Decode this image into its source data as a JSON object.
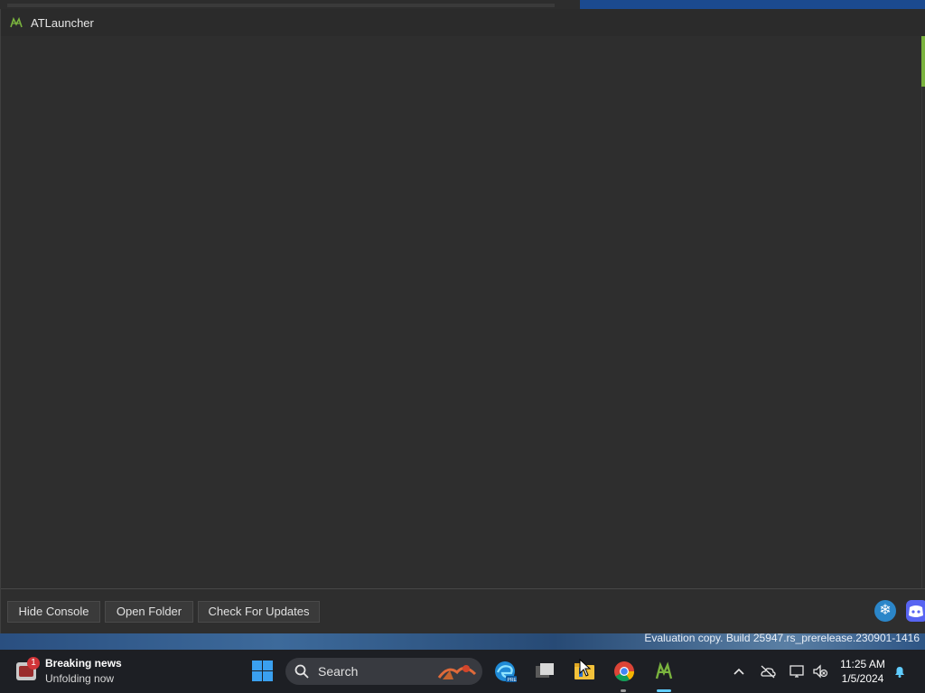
{
  "window": {
    "title": "ATLauncher",
    "accent_color": "#7ab33e"
  },
  "console": {
    "buttons": {
      "hide_console": "Hide Console",
      "open_folder": "Open Folder",
      "check_updates": "Check For Updates"
    },
    "social_icons": [
      "snowflake-icon",
      "discord-icon"
    ]
  },
  "desktop": {
    "watermark": "Evaluation copy. Build 25947.rs_prerelease.230901-1416"
  },
  "taskbar": {
    "news": {
      "badge": "1",
      "title": "Breaking news",
      "subtitle": "Unfolding now"
    },
    "search_label": "Search",
    "pinned_apps": [
      "start-icon",
      "edge-icon",
      "task-view-icon",
      "file-explorer-icon",
      "chrome-icon",
      "atlauncher-icon"
    ],
    "tray_icons": [
      "chevron-up-icon",
      "onedrive-icon",
      "network-icon",
      "volume-muted-icon"
    ],
    "clock": {
      "time": "11:25 AM",
      "date": "1/5/2024"
    }
  }
}
